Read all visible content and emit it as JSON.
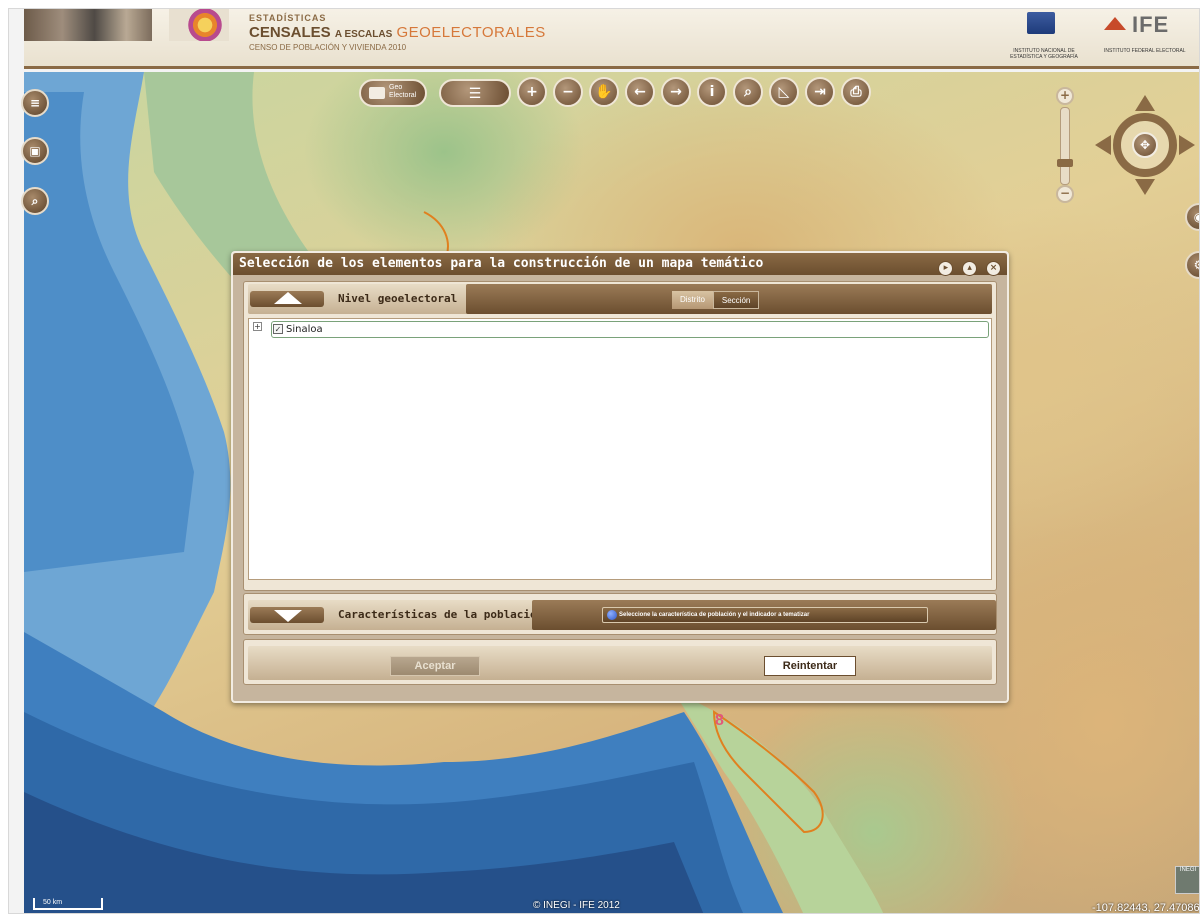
{
  "header": {
    "sup": "ESTADÍSTICAS",
    "title_main": "CENSALES",
    "title_mid": "A ESCALAS",
    "title_geo": "GEOELECTORALES",
    "subtitle": "CENSO DE POBLACIÓN Y VIVIENDA 2010",
    "inegi_name": "INSTITUTO NACIONAL DE ESTADÍSTICA Y GEOGRAFÍA",
    "ife_name": "IFE",
    "ife_full": "INSTITUTO FEDERAL ELECTORAL"
  },
  "toolbar": {
    "geo_label": "Geo Electoral",
    "layers_icon": "layers-list-icon",
    "tools": [
      {
        "name": "zoom-in-icon",
        "glyph": "+"
      },
      {
        "name": "zoom-out-icon",
        "glyph": "−"
      },
      {
        "name": "pan-hand-icon",
        "glyph": "✋"
      },
      {
        "name": "previous-extent-icon",
        "glyph": "←"
      },
      {
        "name": "next-extent-icon",
        "glyph": "→"
      },
      {
        "name": "info-icon",
        "glyph": "i"
      },
      {
        "name": "binoculars-icon",
        "glyph": "⌕"
      },
      {
        "name": "measure-icon",
        "glyph": "◺"
      },
      {
        "name": "exit-icon",
        "glyph": "⇥"
      },
      {
        "name": "print-icon",
        "glyph": "⎙"
      }
    ]
  },
  "left_tools": [
    {
      "name": "layers-icon",
      "glyph": "≡"
    },
    {
      "name": "legend-icon",
      "glyph": "▣"
    },
    {
      "name": "search-icon",
      "glyph": "⌕"
    }
  ],
  "right_tools": [
    {
      "name": "overview-icon",
      "glyph": "◉"
    },
    {
      "name": "settings-icon",
      "glyph": "⚙"
    }
  ],
  "zoom": {
    "plus": "+",
    "minus": "−"
  },
  "pan": {
    "center": "✥"
  },
  "map": {
    "credit": "© INEGI - IFE 2012",
    "coords": "-107.82443, 27.47086",
    "scale_label": "50 km",
    "inegi_mini": "INEGI",
    "district_number": "8"
  },
  "dialog": {
    "title": "Selección de los elementos para la construcción de un mapa temático",
    "ctrl_next": "▸",
    "ctrl_up": "▴",
    "ctrl_close": "×",
    "nivel": {
      "label": "Nivel geoelectoral",
      "options": [
        "Distrito",
        "Sección"
      ],
      "selected": "Distrito"
    },
    "tree": {
      "items": [
        {
          "label": "Sinaloa",
          "checked": true,
          "expander": "+",
          "check_glyph": "✓"
        }
      ]
    },
    "caracteristicas": {
      "label": "Características de la población",
      "button": "Seleccione la característica de población y el indicador a tematizar"
    },
    "buttons": {
      "accept": "Aceptar",
      "retry": "Reintentar"
    }
  }
}
